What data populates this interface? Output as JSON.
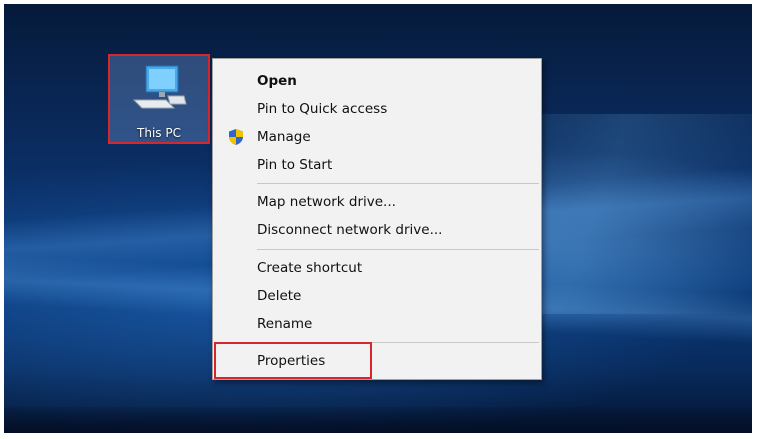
{
  "desktop": {
    "icon": {
      "label": "This PC",
      "icon_name": "this-pc-icon"
    }
  },
  "context_menu": {
    "items": [
      {
        "label": "Open",
        "bold": true
      },
      {
        "label": "Pin to Quick access"
      },
      {
        "label": "Manage",
        "icon": "uac-shield-icon"
      },
      {
        "label": "Pin to Start"
      },
      {
        "label": "Map network drive..."
      },
      {
        "label": "Disconnect network drive..."
      },
      {
        "label": "Create shortcut"
      },
      {
        "label": "Delete"
      },
      {
        "label": "Rename"
      },
      {
        "label": "Properties"
      }
    ]
  },
  "colors": {
    "highlight_border": "#d8262d",
    "menu_background": "#f2f2f2"
  }
}
